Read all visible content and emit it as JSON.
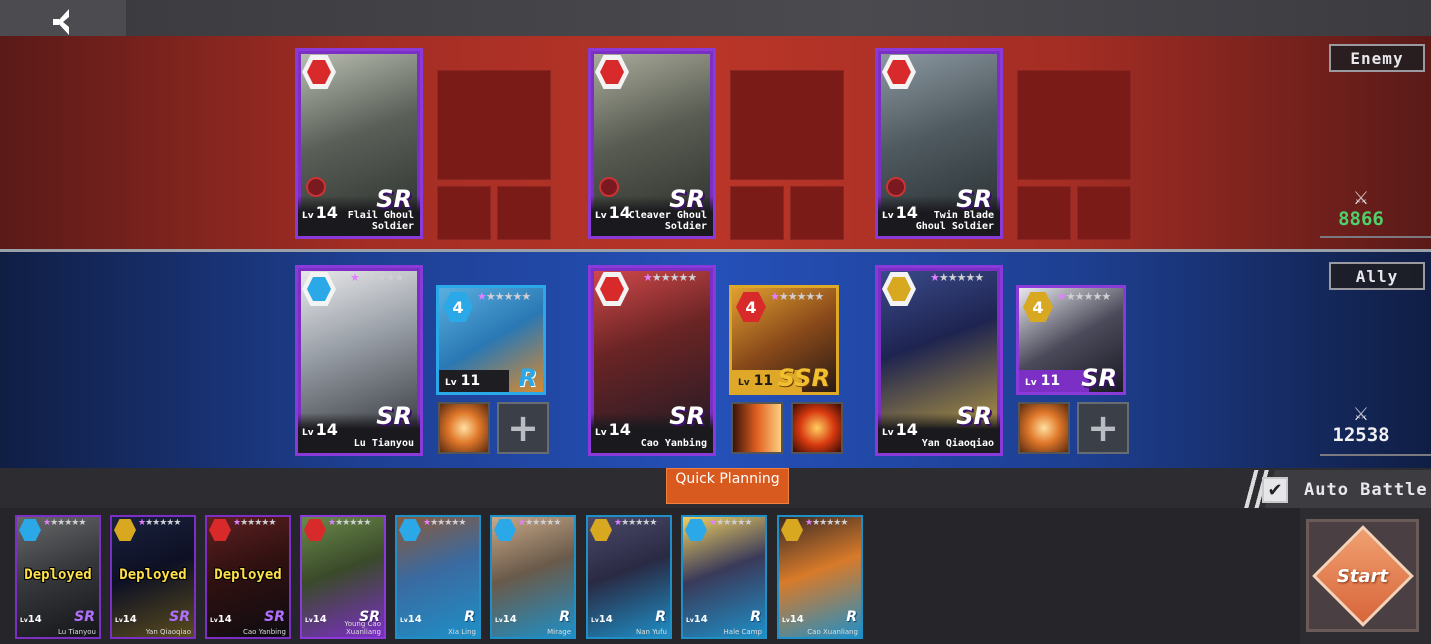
{
  "enemy_label": "Enemy",
  "ally_label": "Ally",
  "enemy_power": "8866",
  "ally_power": "12538",
  "quick_planning": "Quick Planning",
  "auto_battle": "Auto Battle",
  "auto_battle_checked": true,
  "start_label": "Start",
  "enemies": [
    {
      "name": "Flail Ghoul Soldier",
      "rarity": "SR",
      "level": "14"
    },
    {
      "name": "Cleaver Ghoul Soldier",
      "rarity": "SR",
      "level": "14"
    },
    {
      "name": "Twin Blade Ghoul Soldier",
      "rarity": "SR",
      "level": "14"
    }
  ],
  "allies": [
    {
      "name": "Lu Tianyou",
      "rarity": "SR",
      "level": "14",
      "element": "blue",
      "equip": {
        "tier": "4",
        "level": "11",
        "rarity": "R",
        "element": "blue"
      }
    },
    {
      "name": "Cao Yanbing",
      "rarity": "SR",
      "level": "14",
      "element": "red",
      "equip": {
        "tier": "4",
        "level": "11",
        "rarity": "SSR",
        "element": "red"
      }
    },
    {
      "name": "Yan Qiaoqiao",
      "rarity": "SR",
      "level": "14",
      "element": "gold",
      "equip": {
        "tier": "4",
        "level": "11",
        "rarity": "SR",
        "element": "gold"
      }
    }
  ],
  "roster": [
    {
      "name": "Lu Tianyou",
      "rarity": "SR",
      "level": "14",
      "status": "Deployed",
      "element": "blue"
    },
    {
      "name": "Yan Qiaoqiao",
      "rarity": "SR",
      "level": "14",
      "status": "Deployed",
      "element": "gold"
    },
    {
      "name": "Cao Yanbing",
      "rarity": "SR",
      "level": "14",
      "status": "Deployed",
      "element": "red"
    },
    {
      "name": "Young Cao Xuanliang",
      "rarity": "SR",
      "level": "14",
      "status": "",
      "element": "red"
    },
    {
      "name": "Xia Ling",
      "rarity": "R",
      "level": "14",
      "status": "",
      "element": "blue"
    },
    {
      "name": "Mirage",
      "rarity": "R",
      "level": "14",
      "status": "",
      "element": "blue"
    },
    {
      "name": "Nan Yufu",
      "rarity": "R",
      "level": "14",
      "status": "",
      "element": "gold"
    },
    {
      "name": "Hale Camp",
      "rarity": "R",
      "level": "14",
      "status": "",
      "element": "blue"
    },
    {
      "name": "Cao Xuanliang",
      "rarity": "R",
      "level": "14",
      "status": "",
      "element": "gold"
    }
  ],
  "lv_prefix": "Lv",
  "colors": {
    "sr": "#7b2fc4",
    "r": "#1e8fc7",
    "ssr": "#d9a021",
    "red_el": "#d82a2a",
    "blue_el": "#2aa8e8",
    "gold_el": "#d8a820"
  }
}
